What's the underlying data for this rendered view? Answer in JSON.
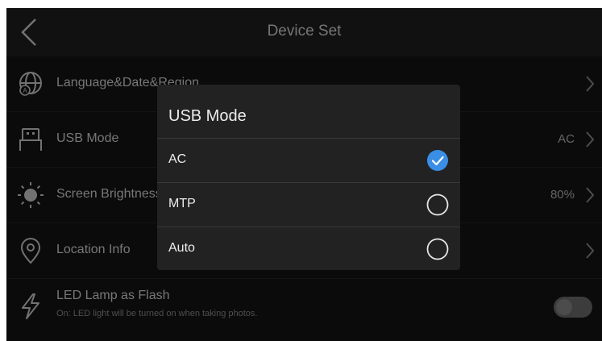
{
  "header": {
    "title": "Device Set",
    "back_icon": "chevron-left-icon"
  },
  "rows": [
    {
      "label": "Language&Date&Region",
      "value": "",
      "icon": "globe-language-icon"
    },
    {
      "label": "USB Mode",
      "value": "AC",
      "icon": "usb-icon"
    },
    {
      "label": "Screen Brightness",
      "value": "80%",
      "icon": "brightness-sun-icon"
    },
    {
      "label": "Location Info",
      "value": "",
      "icon": "location-pin-icon"
    },
    {
      "label": "LED Lamp as Flash",
      "sub": "On: LED light will be turned on when taking photos.",
      "icon": "flash-icon",
      "toggle_on": false
    }
  ],
  "dialog": {
    "title": "USB Mode",
    "options": [
      {
        "label": "AC",
        "selected": true
      },
      {
        "label": "MTP",
        "selected": false
      },
      {
        "label": "Auto",
        "selected": false
      }
    ]
  },
  "colors": {
    "accent": "#3a8ee6",
    "background": "#141414",
    "dialog": "#222222"
  }
}
